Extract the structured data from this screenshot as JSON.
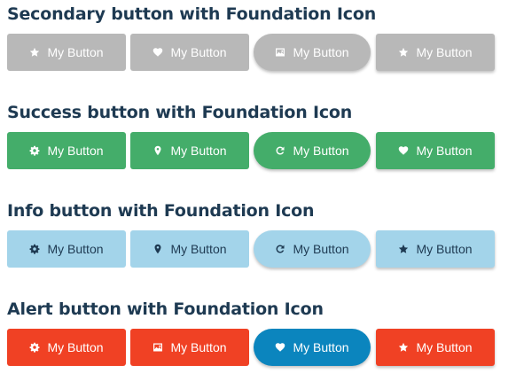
{
  "sections": [
    {
      "title": "Secondary button with Foundation Icon",
      "buttons": [
        {
          "label": "My Button",
          "icon": "star-icon"
        },
        {
          "label": "My Button",
          "icon": "heart-icon"
        },
        {
          "label": "My Button",
          "icon": "photo-icon"
        },
        {
          "label": "My Button",
          "icon": "star-icon"
        }
      ]
    },
    {
      "title": "Success button with Foundation Icon",
      "buttons": [
        {
          "label": "My Button",
          "icon": "gear-icon"
        },
        {
          "label": "My Button",
          "icon": "location-icon"
        },
        {
          "label": "My Button",
          "icon": "refresh-icon"
        },
        {
          "label": "My Button",
          "icon": "heart-icon"
        }
      ]
    },
    {
      "title": "Info button with Foundation Icon",
      "buttons": [
        {
          "label": "My Button",
          "icon": "gear-icon"
        },
        {
          "label": "My Button",
          "icon": "location-icon"
        },
        {
          "label": "My Button",
          "icon": "refresh-icon"
        },
        {
          "label": "My Button",
          "icon": "star-icon"
        }
      ]
    },
    {
      "title": "Alert button with Foundation Icon",
      "buttons": [
        {
          "label": "My Button",
          "icon": "gear-icon"
        },
        {
          "label": "My Button",
          "icon": "photo-icon"
        },
        {
          "label": "My Button",
          "icon": "heart-icon"
        },
        {
          "label": "My Button",
          "icon": "star-icon"
        }
      ]
    }
  ],
  "colors": {
    "heading": "#1e3a52",
    "secondary": "#b8b8b8",
    "success": "#44ad6a",
    "info": "#a3d4ea",
    "alert": "#f04124",
    "alert_round": "#0b85be"
  }
}
